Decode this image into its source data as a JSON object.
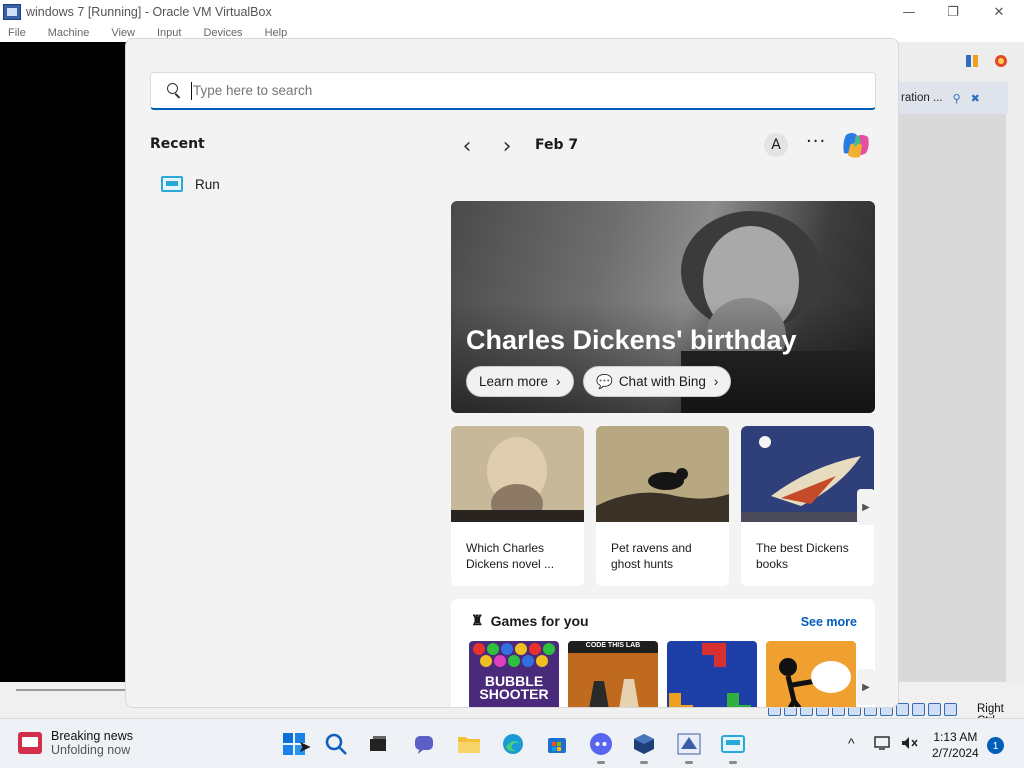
{
  "window": {
    "title": "windows 7 [Running] - Oracle VM VirtualBox",
    "minimize": "—",
    "maximize": "❐",
    "close": "✕"
  },
  "menu": [
    "File",
    "Machine",
    "View",
    "Input",
    "Devices",
    "Help"
  ],
  "guest_right_panel": {
    "strip_text": "ration ..."
  },
  "vbox_status": {
    "host_key": "Right Ctrl"
  },
  "start_menu": {
    "search_placeholder": "Type here to search",
    "recent_title": "Recent",
    "recent_items": [
      {
        "label": "Run",
        "icon": "run-icon"
      }
    ],
    "date_label": "Feb 7",
    "avatar_letter": "A",
    "more_label": "···",
    "hero": {
      "title": "Charles Dickens' birthday",
      "learn_more": "Learn more",
      "chat_with_bing": "Chat with Bing"
    },
    "cards": [
      {
        "caption": "Which Charles Dickens novel ..."
      },
      {
        "caption": "Pet ravens and ghost hunts"
      },
      {
        "caption": "The best Dickens books"
      }
    ],
    "games": {
      "title": "Games for you",
      "see_more": "See more",
      "tiles": [
        {
          "name": "bubble-shooter",
          "text": "BUBBLE SHOOTER"
        },
        {
          "name": "codethislab-chess",
          "text": "CODE THIS LAB"
        },
        {
          "name": "block-puzzle",
          "text": ""
        },
        {
          "name": "stickman-game",
          "text": ""
        }
      ]
    }
  },
  "taskbar": {
    "news_title": "Breaking news",
    "news_subtitle": "Unfolding now",
    "time": "1:13 AM",
    "date": "2/7/2024",
    "notification_count": "1",
    "apps": [
      "start-icon",
      "search-icon",
      "task-view-icon",
      "chat-icon",
      "file-explorer-icon",
      "edge-icon",
      "store-icon",
      "discord-icon",
      "virtualbox-icon",
      "win7-vm-icon",
      "run-app-icon"
    ]
  },
  "colors": {
    "accent": "#005fb8",
    "see_more": "#005fb8",
    "news_icon": "#d2304a"
  }
}
